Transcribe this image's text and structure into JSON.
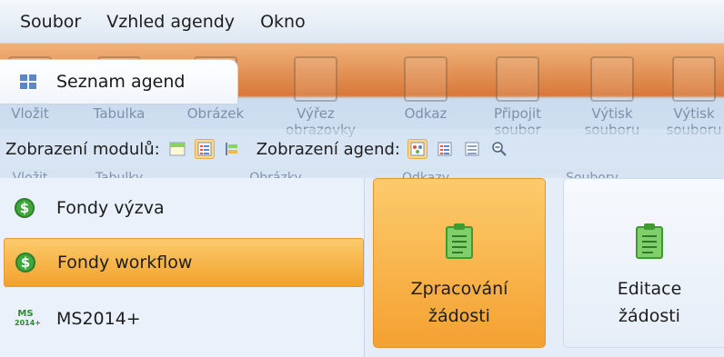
{
  "menu": [
    "Soubor",
    "Vzhled agendy",
    "Okno"
  ],
  "tab": {
    "label": "Seznam agend"
  },
  "ribbon_ghost": {
    "items": [
      {
        "name": "insert",
        "line1": "Vložit",
        "line2": ""
      },
      {
        "name": "table",
        "line1": "Tabulka",
        "line2": ""
      },
      {
        "name": "image",
        "line1": "Obrázek",
        "line2": ""
      },
      {
        "name": "crop",
        "line1": "Výřez",
        "line2": "obrazovky"
      },
      {
        "name": "link",
        "line1": "Odkaz",
        "line2": ""
      },
      {
        "name": "attach",
        "line1": "Připojit",
        "line2": "soubor"
      },
      {
        "name": "print",
        "line1": "Výtisk",
        "line2": "souboru"
      },
      {
        "name": "print2",
        "line1": "Výtisk",
        "line2": "souboru"
      }
    ],
    "groups": [
      "Vložit",
      "Tabulky",
      "Obrázky",
      "Odkazy",
      "Soubory"
    ]
  },
  "viewbar": {
    "module_label": "Zobrazení modulů:",
    "agenda_label": "Zobrazení agend:"
  },
  "sidebar": [
    {
      "label": "Fondy výzva",
      "icon": "dollar-icon",
      "active": false
    },
    {
      "label": "Fondy workflow",
      "icon": "dollar-icon",
      "active": true
    },
    {
      "label": "MS2014+",
      "icon": "ms2014-icon",
      "active": false
    }
  ],
  "ms_icon_text": {
    "top": "MS",
    "bottom": "2014+"
  },
  "tiles": [
    {
      "line1": "Zpracování",
      "line2": "žádosti",
      "active": true
    },
    {
      "line1": "Editace",
      "line2": "žádosti",
      "active": false
    }
  ],
  "colors": {
    "accent": "#f4a131",
    "accent_border": "#e0962c",
    "clip_green": "#59b84a"
  }
}
